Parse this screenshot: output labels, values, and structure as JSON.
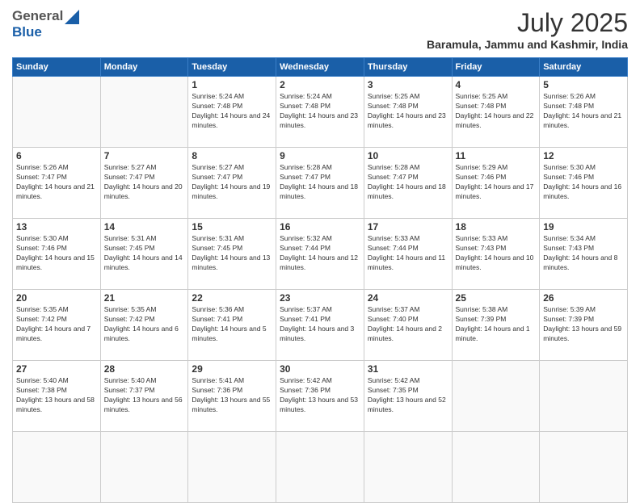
{
  "header": {
    "logo_general": "General",
    "logo_blue": "Blue",
    "month": "July 2025",
    "location": "Baramula, Jammu and Kashmir, India"
  },
  "weekdays": [
    "Sunday",
    "Monday",
    "Tuesday",
    "Wednesday",
    "Thursday",
    "Friday",
    "Saturday"
  ],
  "days": [
    {
      "date": "",
      "info": ""
    },
    {
      "date": "",
      "info": ""
    },
    {
      "date": "1",
      "info": "Sunrise: 5:24 AM\nSunset: 7:48 PM\nDaylight: 14 hours and 24 minutes."
    },
    {
      "date": "2",
      "info": "Sunrise: 5:24 AM\nSunset: 7:48 PM\nDaylight: 14 hours and 23 minutes."
    },
    {
      "date": "3",
      "info": "Sunrise: 5:25 AM\nSunset: 7:48 PM\nDaylight: 14 hours and 23 minutes."
    },
    {
      "date": "4",
      "info": "Sunrise: 5:25 AM\nSunset: 7:48 PM\nDaylight: 14 hours and 22 minutes."
    },
    {
      "date": "5",
      "info": "Sunrise: 5:26 AM\nSunset: 7:48 PM\nDaylight: 14 hours and 21 minutes."
    },
    {
      "date": "6",
      "info": "Sunrise: 5:26 AM\nSunset: 7:47 PM\nDaylight: 14 hours and 21 minutes."
    },
    {
      "date": "7",
      "info": "Sunrise: 5:27 AM\nSunset: 7:47 PM\nDaylight: 14 hours and 20 minutes."
    },
    {
      "date": "8",
      "info": "Sunrise: 5:27 AM\nSunset: 7:47 PM\nDaylight: 14 hours and 19 minutes."
    },
    {
      "date": "9",
      "info": "Sunrise: 5:28 AM\nSunset: 7:47 PM\nDaylight: 14 hours and 18 minutes."
    },
    {
      "date": "10",
      "info": "Sunrise: 5:28 AM\nSunset: 7:47 PM\nDaylight: 14 hours and 18 minutes."
    },
    {
      "date": "11",
      "info": "Sunrise: 5:29 AM\nSunset: 7:46 PM\nDaylight: 14 hours and 17 minutes."
    },
    {
      "date": "12",
      "info": "Sunrise: 5:30 AM\nSunset: 7:46 PM\nDaylight: 14 hours and 16 minutes."
    },
    {
      "date": "13",
      "info": "Sunrise: 5:30 AM\nSunset: 7:46 PM\nDaylight: 14 hours and 15 minutes."
    },
    {
      "date": "14",
      "info": "Sunrise: 5:31 AM\nSunset: 7:45 PM\nDaylight: 14 hours and 14 minutes."
    },
    {
      "date": "15",
      "info": "Sunrise: 5:31 AM\nSunset: 7:45 PM\nDaylight: 14 hours and 13 minutes."
    },
    {
      "date": "16",
      "info": "Sunrise: 5:32 AM\nSunset: 7:44 PM\nDaylight: 14 hours and 12 minutes."
    },
    {
      "date": "17",
      "info": "Sunrise: 5:33 AM\nSunset: 7:44 PM\nDaylight: 14 hours and 11 minutes."
    },
    {
      "date": "18",
      "info": "Sunrise: 5:33 AM\nSunset: 7:43 PM\nDaylight: 14 hours and 10 minutes."
    },
    {
      "date": "19",
      "info": "Sunrise: 5:34 AM\nSunset: 7:43 PM\nDaylight: 14 hours and 8 minutes."
    },
    {
      "date": "20",
      "info": "Sunrise: 5:35 AM\nSunset: 7:42 PM\nDaylight: 14 hours and 7 minutes."
    },
    {
      "date": "21",
      "info": "Sunrise: 5:35 AM\nSunset: 7:42 PM\nDaylight: 14 hours and 6 minutes."
    },
    {
      "date": "22",
      "info": "Sunrise: 5:36 AM\nSunset: 7:41 PM\nDaylight: 14 hours and 5 minutes."
    },
    {
      "date": "23",
      "info": "Sunrise: 5:37 AM\nSunset: 7:41 PM\nDaylight: 14 hours and 3 minutes."
    },
    {
      "date": "24",
      "info": "Sunrise: 5:37 AM\nSunset: 7:40 PM\nDaylight: 14 hours and 2 minutes."
    },
    {
      "date": "25",
      "info": "Sunrise: 5:38 AM\nSunset: 7:39 PM\nDaylight: 14 hours and 1 minute."
    },
    {
      "date": "26",
      "info": "Sunrise: 5:39 AM\nSunset: 7:39 PM\nDaylight: 13 hours and 59 minutes."
    },
    {
      "date": "27",
      "info": "Sunrise: 5:40 AM\nSunset: 7:38 PM\nDaylight: 13 hours and 58 minutes."
    },
    {
      "date": "28",
      "info": "Sunrise: 5:40 AM\nSunset: 7:37 PM\nDaylight: 13 hours and 56 minutes."
    },
    {
      "date": "29",
      "info": "Sunrise: 5:41 AM\nSunset: 7:36 PM\nDaylight: 13 hours and 55 minutes."
    },
    {
      "date": "30",
      "info": "Sunrise: 5:42 AM\nSunset: 7:36 PM\nDaylight: 13 hours and 53 minutes."
    },
    {
      "date": "31",
      "info": "Sunrise: 5:42 AM\nSunset: 7:35 PM\nDaylight: 13 hours and 52 minutes."
    },
    {
      "date": "",
      "info": ""
    },
    {
      "date": "",
      "info": ""
    },
    {
      "date": "",
      "info": ""
    },
    {
      "date": "",
      "info": ""
    },
    {
      "date": "",
      "info": ""
    },
    {
      "date": "",
      "info": ""
    },
    {
      "date": "",
      "info": ""
    },
    {
      "date": "",
      "info": ""
    },
    {
      "date": "",
      "info": ""
    },
    {
      "date": "",
      "info": ""
    }
  ]
}
